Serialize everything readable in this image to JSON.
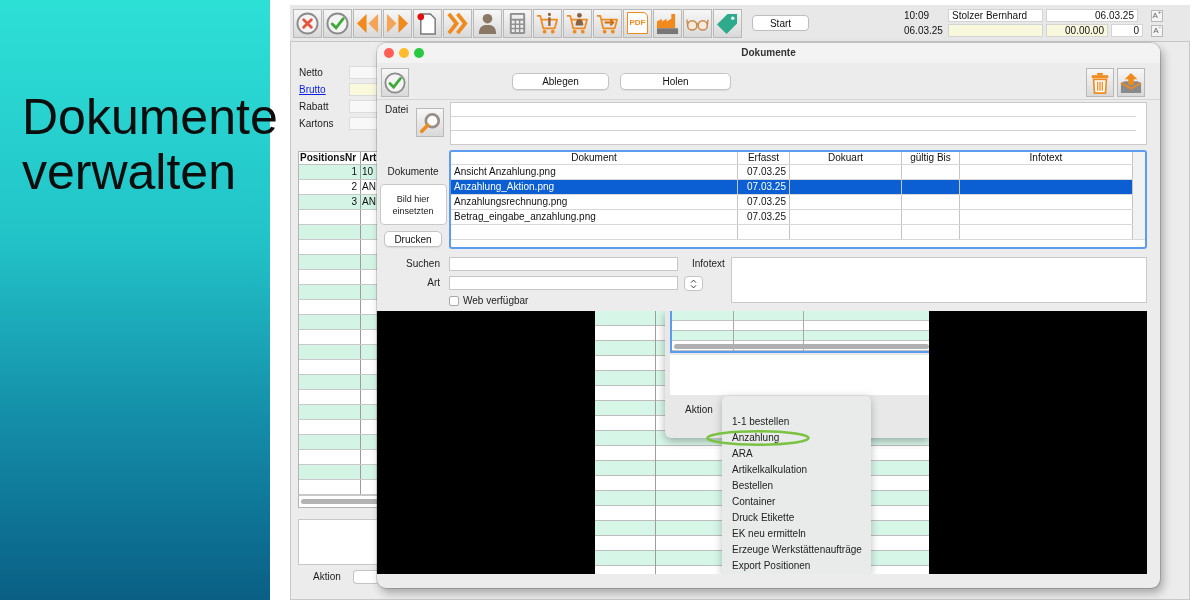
{
  "intro": {
    "heading": "Dokumente verwalten"
  },
  "toolbar": {
    "pdf_text": "PDF",
    "start": "Start"
  },
  "session": {
    "time": "10:09",
    "user": "Stolzer Bernhard",
    "date_field": "06.03.25",
    "date": "06.03.25",
    "time_field": "00.00.00",
    "count": "0",
    "font_buttons": [
      "A$^{+}$",
      "A$^{-}$"
    ]
  },
  "main_window": {
    "fields": [
      {
        "label": "Netto",
        "link": false,
        "highlighted": false
      },
      {
        "label": "Brutto",
        "link": true,
        "highlighted": true
      },
      {
        "label": "Rabatt",
        "link": false,
        "highlighted": false
      },
      {
        "label": "Kartons",
        "link": false,
        "highlighted": false
      }
    ],
    "positions": {
      "columns": [
        "PositionsNr",
        "Art"
      ],
      "rows": [
        [
          "1",
          "10"
        ],
        [
          "2",
          "AN"
        ],
        [
          "3",
          "AN"
        ]
      ]
    },
    "action_label": "Aktion"
  },
  "dialog": {
    "title": "Dokumente",
    "buttons": [
      "Ablegen",
      "Holen"
    ],
    "file_label": "Datei",
    "documents_label": "Dokumente",
    "drop_area": "Bild hier einsetzten",
    "print_button": "Drucken",
    "table": {
      "columns": [
        "Dokument",
        "Erfasst",
        "Dokuart",
        "gültig Bis",
        "Infotext"
      ],
      "rows": [
        {
          "document": "Ansicht Anzahlung.png",
          "captured": "07.03.25",
          "selected": false
        },
        {
          "document": "Anzahlung_Aktion.png",
          "captured": "07.03.25",
          "selected": true
        },
        {
          "document": "Anzahlungsrechnung.png",
          "captured": "07.03.25",
          "selected": false
        },
        {
          "document": "Betrag_eingabe_anzahlung.png",
          "captured": "07.03.25",
          "selected": false
        }
      ]
    },
    "search": {
      "search_label": "Suchen",
      "type_label": "Art",
      "infotext_label": "Infotext",
      "web_available": {
        "label": "Web verfügbar",
        "checked": false
      }
    },
    "preview": {
      "action_label": "Aktion",
      "menu": [
        {
          "label": "1-1 bestellen",
          "circled": false
        },
        {
          "label": "Anzahlung",
          "circled": true
        },
        {
          "label": "ARA",
          "circled": false
        },
        {
          "label": "Artikelkalkulation",
          "circled": false
        },
        {
          "label": "Bestellen",
          "circled": false
        },
        {
          "label": "Container",
          "circled": false
        },
        {
          "label": "Druck Etikette",
          "circled": false
        },
        {
          "label": "EK neu ermitteln",
          "circled": false
        },
        {
          "label": "Erzeuge Werkstättenaufträge",
          "circled": false
        },
        {
          "label": "Export Positionen",
          "circled": false
        }
      ]
    }
  }
}
